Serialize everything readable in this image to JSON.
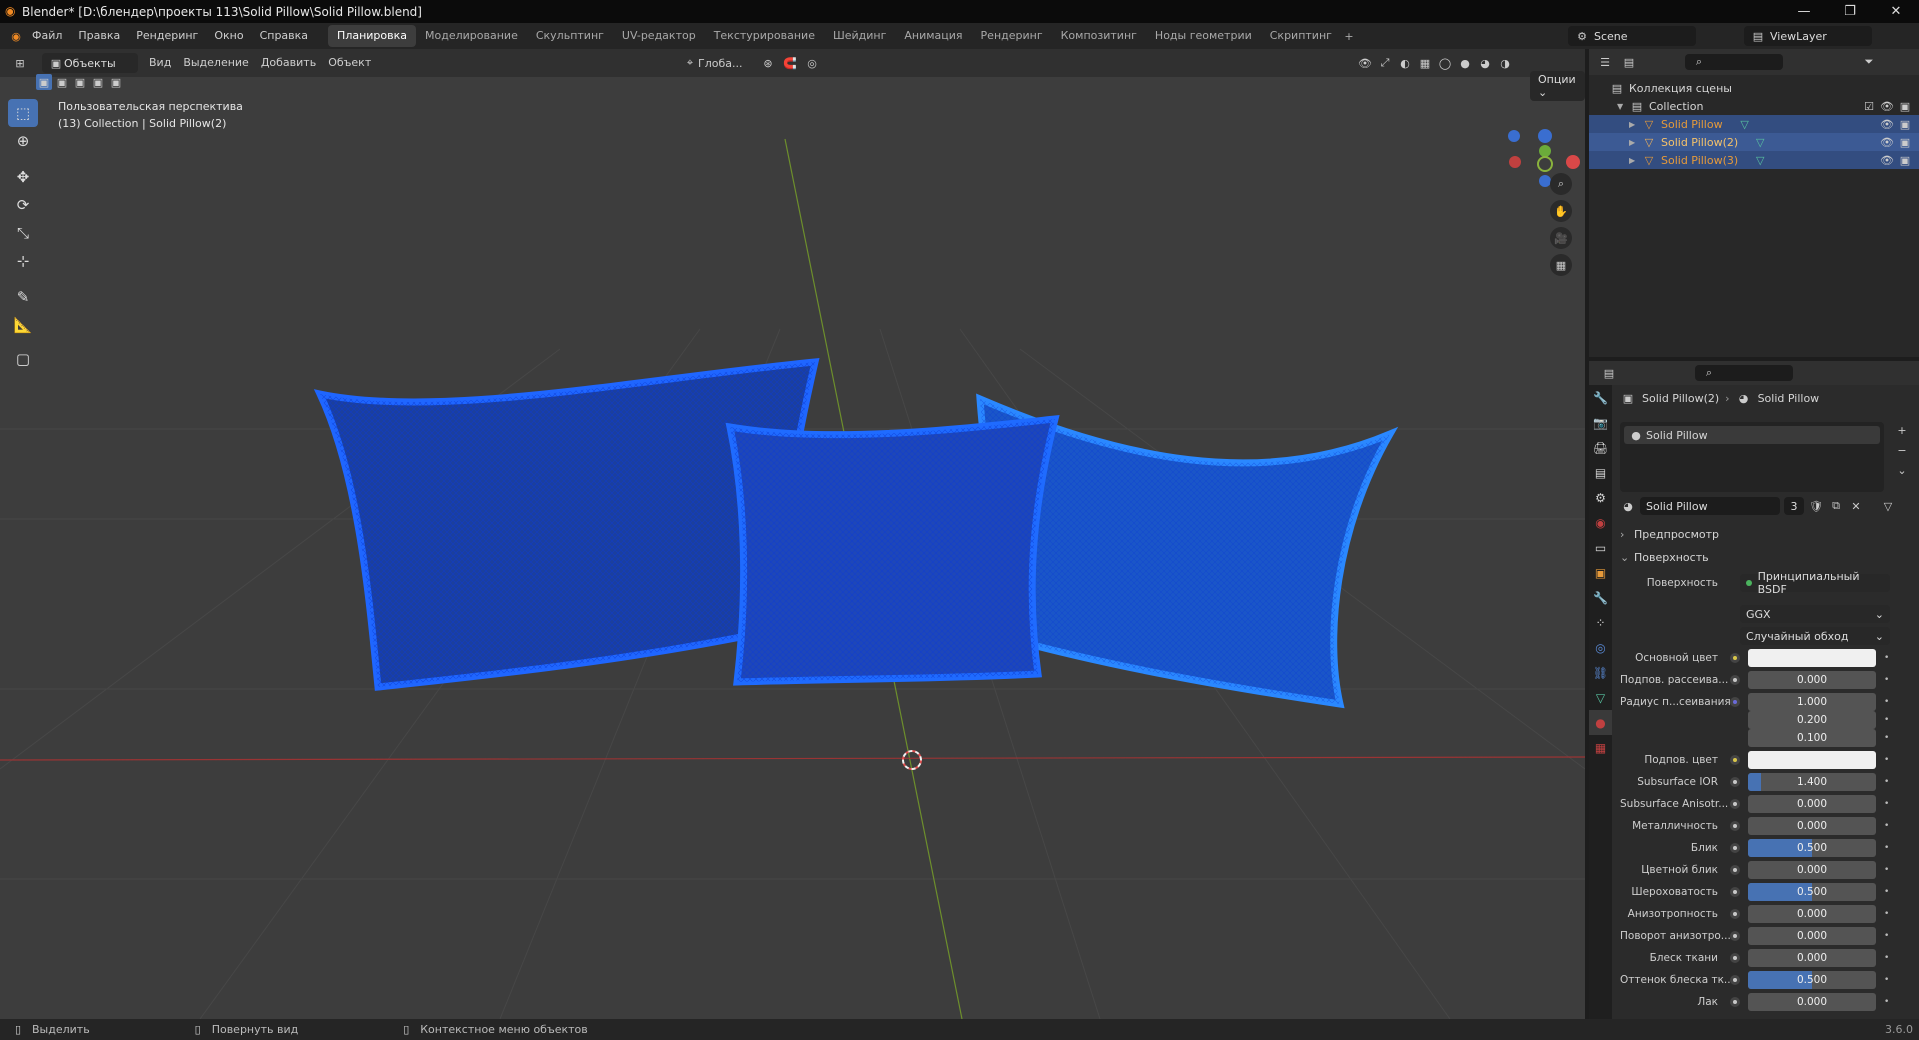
{
  "window": {
    "title": "Blender* [D:\\блендер\\проекты 113\\Solid Pillow\\Solid Pillow.blend]"
  },
  "menu": [
    "Файл",
    "Правка",
    "Рендеринг",
    "Окно",
    "Справка"
  ],
  "workspaces": [
    "Планировка",
    "Моделирование",
    "Скульптинг",
    "UV-редактор",
    "Текстурирование",
    "Шейдинг",
    "Анимация",
    "Рендеринг",
    "Композитинг",
    "Ноды геометрии",
    "Скриптинг"
  ],
  "scene": {
    "name": "Scene",
    "view_layer": "ViewLayer"
  },
  "viewport": {
    "mode": "Объекты",
    "menus": [
      "Вид",
      "Выделение",
      "Добавить",
      "Объект"
    ],
    "orientation": "Глоба...",
    "options": "Опции",
    "overlay_title": "Пользовательская перспектива",
    "overlay_sub": "(13) Collection | Solid Pillow(2)"
  },
  "outliner": {
    "scene_collection": "Коллекция сцены",
    "collection": "Collection",
    "objects": [
      "Solid Pillow",
      "Solid Pillow(2)",
      "Solid Pillow(3)"
    ]
  },
  "properties": {
    "breadcrumb_obj": "Solid Pillow(2)",
    "breadcrumb_mat": "Solid Pillow",
    "slot": "Solid Pillow",
    "material": "Solid Pillow",
    "users": "3",
    "panel_preview": "Предпросмотр",
    "panel_surface": "Поверхность",
    "surface_label": "Поверхность",
    "surface_value": "Принципиальный BSDF",
    "distribution": "GGX",
    "subsurface_method": "Случайный обход",
    "rows": [
      {
        "label": "Основной цвет",
        "type": "color",
        "value": ""
      },
      {
        "label": "Подпов. рассеива...",
        "type": "num",
        "value": "0.000",
        "fill": 0
      },
      {
        "label": "Радиус п...сеивания",
        "type": "num",
        "value": "1.000",
        "fill": 0
      },
      {
        "label": "",
        "type": "num",
        "value": "0.200",
        "fill": 0
      },
      {
        "label": "",
        "type": "num",
        "value": "0.100",
        "fill": 0
      },
      {
        "label": "Подпов. цвет",
        "type": "color",
        "value": ""
      },
      {
        "label": "Subsurface IOR",
        "type": "num",
        "value": "1.400",
        "fill": 0.1
      },
      {
        "label": "Subsurface Anisotr...",
        "type": "num",
        "value": "0.000",
        "fill": 0
      },
      {
        "label": "Металличность",
        "type": "num",
        "value": "0.000",
        "fill": 0
      },
      {
        "label": "Блик",
        "type": "num",
        "value": "0.500",
        "fill": 0.5
      },
      {
        "label": "Цветной блик",
        "type": "num",
        "value": "0.000",
        "fill": 0
      },
      {
        "label": "Шероховатость",
        "type": "num",
        "value": "0.500",
        "fill": 0.5
      },
      {
        "label": "Анизотропность",
        "type": "num",
        "value": "0.000",
        "fill": 0
      },
      {
        "label": "Поворот анизотро...",
        "type": "num",
        "value": "0.000",
        "fill": 0
      },
      {
        "label": "Блеск ткани",
        "type": "num",
        "value": "0.000",
        "fill": 0
      },
      {
        "label": "Оттенок блеска тк...",
        "type": "num",
        "value": "0.500",
        "fill": 0.5
      },
      {
        "label": "Лак",
        "type": "num",
        "value": "0.000",
        "fill": 0
      }
    ]
  },
  "status": {
    "select": "Выделить",
    "rotate": "Повернуть вид",
    "context": "Контекстное меню объектов",
    "version": "3.6.0"
  },
  "colors": {
    "accent": "#4772b3",
    "selected_row": "#334d80",
    "pillow": "#1a5cff",
    "x_axis": "#c0403f",
    "y_axis": "#8ab33d"
  }
}
